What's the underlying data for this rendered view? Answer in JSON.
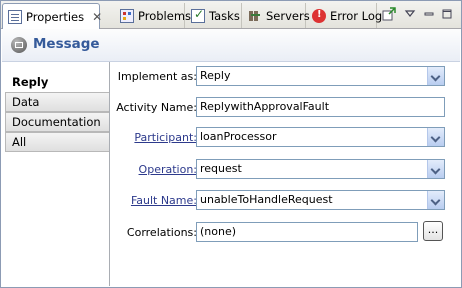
{
  "tabs": [
    {
      "label": "Properties",
      "icon": "properties-icon",
      "active": true
    },
    {
      "label": "Problems",
      "icon": "problems-icon"
    },
    {
      "label": "Tasks",
      "icon": "tasks-icon"
    },
    {
      "label": "Servers",
      "icon": "servers-icon"
    },
    {
      "label": "Error Log",
      "icon": "error-log-icon"
    }
  ],
  "toolbar": {
    "pin_icon": "pin-icon",
    "menu_icon": "view-menu-icon",
    "minimize_icon": "minimize-icon",
    "maximize_icon": "maximize-icon"
  },
  "header": {
    "title": "Message",
    "icon": "message-icon"
  },
  "nav": {
    "items": [
      {
        "label": "Reply",
        "selected": true
      },
      {
        "label": "Data"
      },
      {
        "label": "Documentation"
      },
      {
        "label": "All"
      }
    ]
  },
  "form": {
    "implement_as": {
      "label": "Implement as:",
      "value": "Reply"
    },
    "activity_name": {
      "label": "Activity Name:",
      "value": "ReplywithApprovalFault"
    },
    "participant": {
      "label": "Participant:",
      "value": "loanProcessor"
    },
    "operation": {
      "label": "Operation:",
      "value": "request"
    },
    "fault_name": {
      "label": "Fault Name:",
      "value": "unableToHandleRequest"
    },
    "correlations": {
      "label": "Correlations:",
      "value": "(none)",
      "button": "..."
    }
  },
  "colors": {
    "accent": "#355a9a",
    "link": "#2d3a8c"
  }
}
